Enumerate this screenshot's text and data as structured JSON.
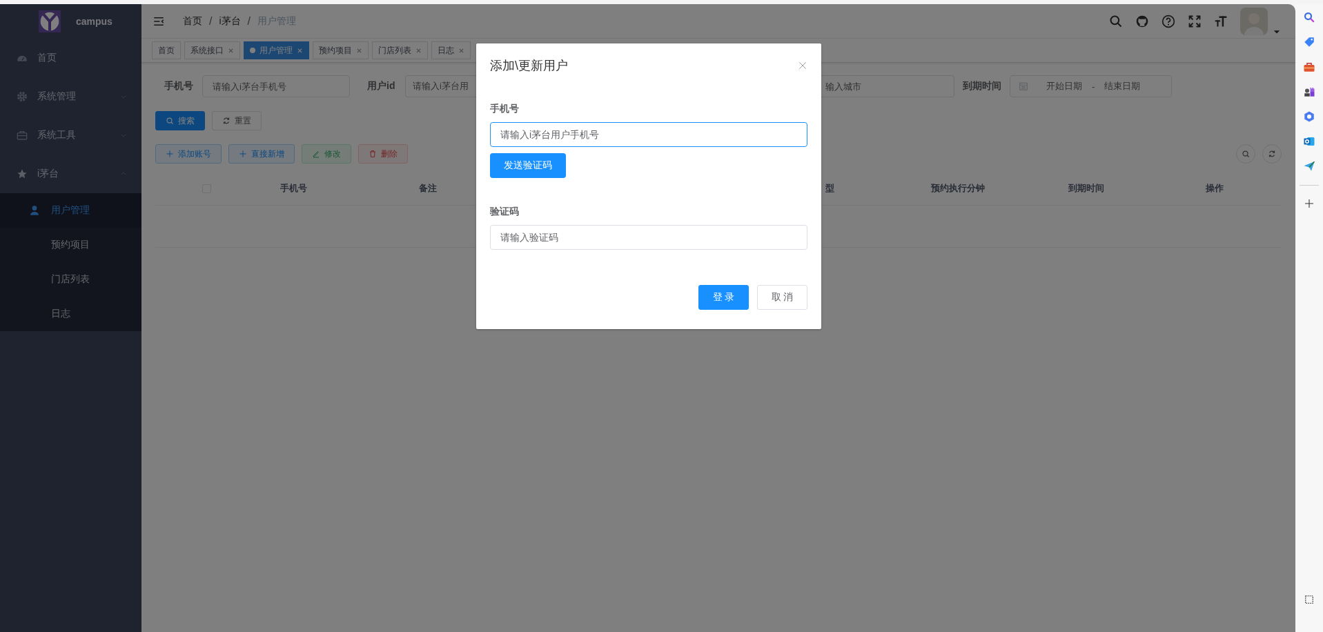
{
  "sidebar": {
    "logo_text": "campus",
    "menu": [
      {
        "label": "首页"
      },
      {
        "label": "系统管理",
        "expanded": false
      },
      {
        "label": "系统工具",
        "expanded": false
      },
      {
        "label": "i茅台",
        "expanded": true,
        "children": [
          {
            "label": "用户管理",
            "selected": true
          },
          {
            "label": "预约项目",
            "selected": false
          },
          {
            "label": "门店列表",
            "selected": false
          },
          {
            "label": "日志",
            "selected": false
          }
        ]
      }
    ]
  },
  "header": {
    "breadcrumb": [
      "首页",
      "i茅台",
      "用户管理"
    ],
    "breadcrumb_separator": "/"
  },
  "tabs": [
    {
      "label": "首页",
      "selected": false,
      "closable": false
    },
    {
      "label": "系统接口",
      "selected": false,
      "closable": true
    },
    {
      "label": "用户管理",
      "selected": true,
      "closable": true
    },
    {
      "label": "预约项目",
      "selected": false,
      "closable": true
    },
    {
      "label": "门店列表",
      "selected": false,
      "closable": true
    },
    {
      "label": "日志",
      "selected": false,
      "closable": true
    }
  ],
  "filters": [
    {
      "kind": "text",
      "label": "手机号",
      "placeholder": "请输入i茅台手机号"
    },
    {
      "kind": "text-cut-right",
      "label": "用户id",
      "placeholder": "请输入i茅台用"
    },
    {
      "kind": "text-cut-left",
      "placeholder": "输入城市"
    },
    {
      "kind": "date-range",
      "label": "到期时间",
      "start_placeholder": "开始日期",
      "separator": "-",
      "end_placeholder": "结束日期"
    }
  ],
  "search_buttons": [
    {
      "label": "搜索",
      "kind": "primary"
    },
    {
      "label": "重置",
      "kind": "default"
    }
  ],
  "toolbar": [
    {
      "label": "添加账号",
      "kind": "primary",
      "disabled": false
    },
    {
      "label": "直接新增",
      "kind": "info",
      "disabled": false
    },
    {
      "label": "修改",
      "kind": "success",
      "disabled": true
    },
    {
      "label": "删除",
      "kind": "danger",
      "disabled": true
    }
  ],
  "table": {
    "select_all": {
      "checked": false
    },
    "columns_left": [
      "手机号",
      "备注"
    ],
    "columns_right": [
      "型",
      "预约执行分钟",
      "到期时间",
      "操作"
    ]
  },
  "dialog": {
    "title": "添加\\更新用户",
    "fields": [
      {
        "label": "手机号",
        "placeholder": "请输入i茅台用户手机号",
        "focused": true
      },
      {
        "label": "验证码",
        "placeholder": "请输入验证码",
        "focused": false
      }
    ],
    "send_code_button": "发送验证码",
    "buttons": [
      {
        "label": "登 录",
        "kind": "primary"
      },
      {
        "label": "取 消",
        "kind": "default"
      }
    ]
  }
}
